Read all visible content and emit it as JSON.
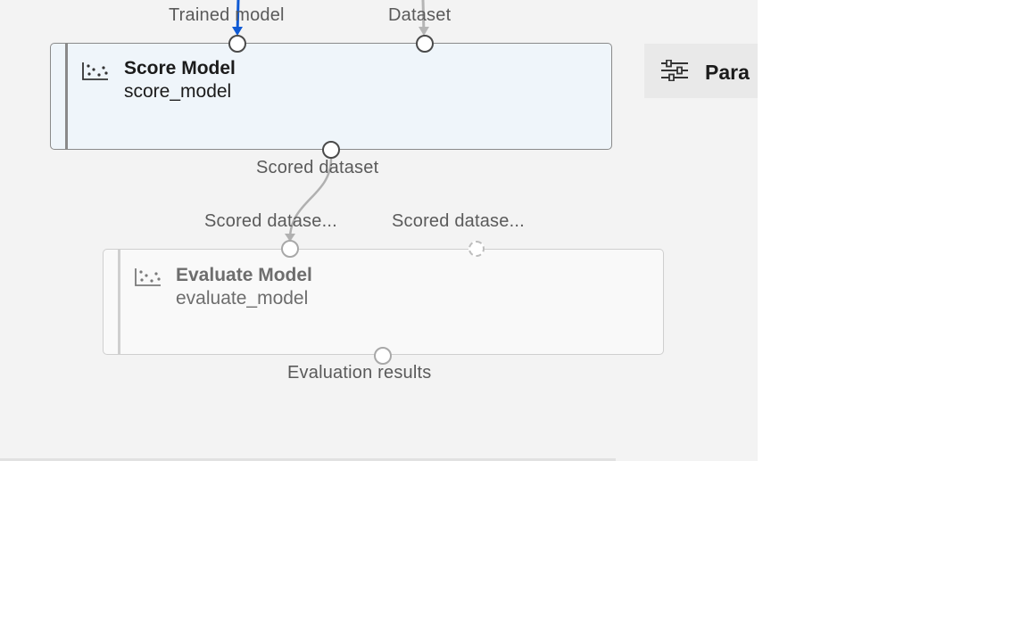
{
  "score_module": {
    "title": "Score Model",
    "subtitle": "score_model",
    "inputs": {
      "trained_model": "Trained model",
      "dataset": "Dataset"
    },
    "output": "Scored dataset"
  },
  "evaluate_module": {
    "title": "Evaluate Model",
    "subtitle": "evaluate_model",
    "inputs": {
      "scored_dataset_1": "Scored datase...",
      "scored_dataset_2": "Scored datase..."
    },
    "output": "Evaluation results"
  },
  "side_panel": {
    "tab_label": "Para",
    "tab_icon": "sliders-icon"
  },
  "colors": {
    "canvas": "#f3f3f3",
    "selected_module_bg": "#eff5fa",
    "active_connector": "#0f5ad4",
    "connector": "#b0b0b0"
  }
}
